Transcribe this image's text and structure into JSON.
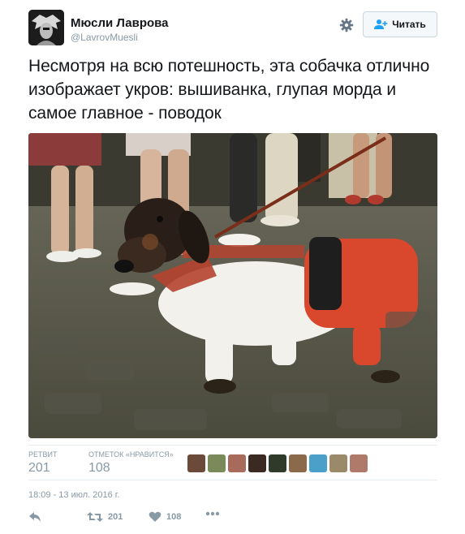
{
  "user": {
    "name": "Мюсли Лаврова",
    "handle": "@LavrovMuesli"
  },
  "header": {
    "follow_label": "Читать"
  },
  "tweet": {
    "text": "Несмотря на всю потешность, эта собачка отлично изображает укров: вышиванка, глупая морда и самое главное - поводок",
    "timestamp": "18:09 - 13 июл. 2016 г."
  },
  "stats": {
    "retweets_label": "РЕТВИТ",
    "retweets_count": "201",
    "likes_label": "ОТМЕТОК «НРАВИТСЯ»",
    "likes_count": "108",
    "liker_avatar_colors": [
      "#6b4a3a",
      "#7a8a5a",
      "#a86a5a",
      "#3a2a22",
      "#2f3a2a",
      "#8a6a4a",
      "#4aa0c8",
      "#9a8a6a",
      "#b07a6a"
    ]
  },
  "actions": {
    "retweet_count": "201",
    "like_count": "108"
  },
  "icons": {
    "settings": "gear-icon",
    "follow": "follow-user-icon",
    "reply": "reply-icon",
    "retweet": "retweet-icon",
    "like": "heart-icon",
    "more": "more-dots-icon"
  },
  "colors": {
    "text": "#14171a",
    "muted": "#8899a6",
    "follow_icon": "#1da1f2",
    "border": "#e6ecf0"
  }
}
